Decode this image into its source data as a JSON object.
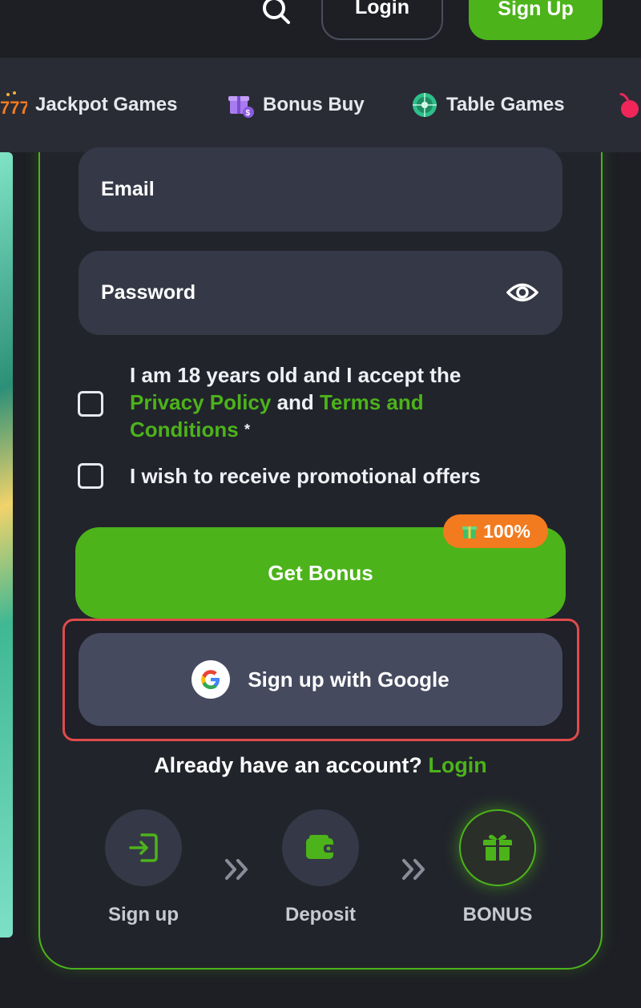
{
  "header": {
    "login_label": "Login",
    "signup_label": "Sign Up"
  },
  "categories": [
    {
      "label": "Jackpot Games",
      "icon": "jackpot-icon"
    },
    {
      "label": "Bonus Buy",
      "icon": "gift-bonus-icon"
    },
    {
      "label": "Table Games",
      "icon": "roulette-icon"
    },
    {
      "label": "",
      "icon": "cherry-icon"
    }
  ],
  "form": {
    "email_placeholder": "Email",
    "password_placeholder": "Password",
    "age_text_1": "I am 18 years old and I accept the",
    "privacy_link": "Privacy Policy",
    "and_text": "and",
    "terms_link": "Terms and Conditions",
    "asterisk": "*",
    "promo_text": "I wish to receive promotional offers",
    "get_bonus_label": "Get Bonus",
    "bonus_badge": "100%",
    "google_label": "Sign up with Google",
    "already_text": "Already have an account?",
    "login_link": "Login"
  },
  "steps": [
    {
      "label": "Sign up",
      "icon": "sign-in-icon"
    },
    {
      "label": "Deposit",
      "icon": "wallet-icon"
    },
    {
      "label": "BONUS",
      "icon": "gift-icon"
    }
  ],
  "colors": {
    "accent_green": "#4cb31a",
    "badge_orange": "#f27b1f",
    "highlight_red": "#e04b4b"
  }
}
